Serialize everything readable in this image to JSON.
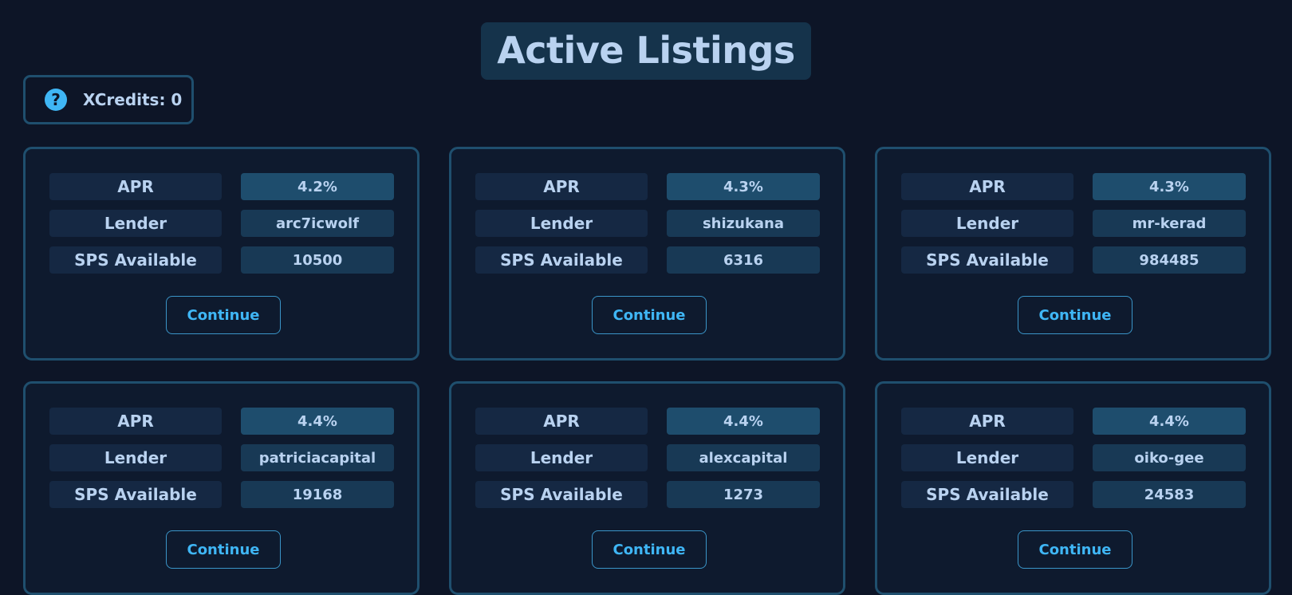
{
  "header": {
    "title": "Active Listings"
  },
  "xcredits": {
    "icon": "question-icon",
    "text": "XCredits: 0"
  },
  "labels": {
    "apr": "APR",
    "lender": "Lender",
    "sps_available": "SPS Available",
    "continue": "Continue"
  },
  "listings": [
    {
      "apr": "4.2%",
      "lender": "arc7icwolf",
      "sps_available": "10500"
    },
    {
      "apr": "4.3%",
      "lender": "shizukana",
      "sps_available": "6316"
    },
    {
      "apr": "4.3%",
      "lender": "mr-kerad",
      "sps_available": "984485"
    },
    {
      "apr": "4.4%",
      "lender": "patriciacapital",
      "sps_available": "19168"
    },
    {
      "apr": "4.4%",
      "lender": "alexcapital",
      "sps_available": "1273"
    },
    {
      "apr": "4.4%",
      "lender": "oiko-gee",
      "sps_available": "24583"
    }
  ],
  "colors": {
    "background": "#0d1527",
    "accent": "#3fb6f5",
    "border": "#1f4f6e",
    "text": "#b9d2f0"
  }
}
